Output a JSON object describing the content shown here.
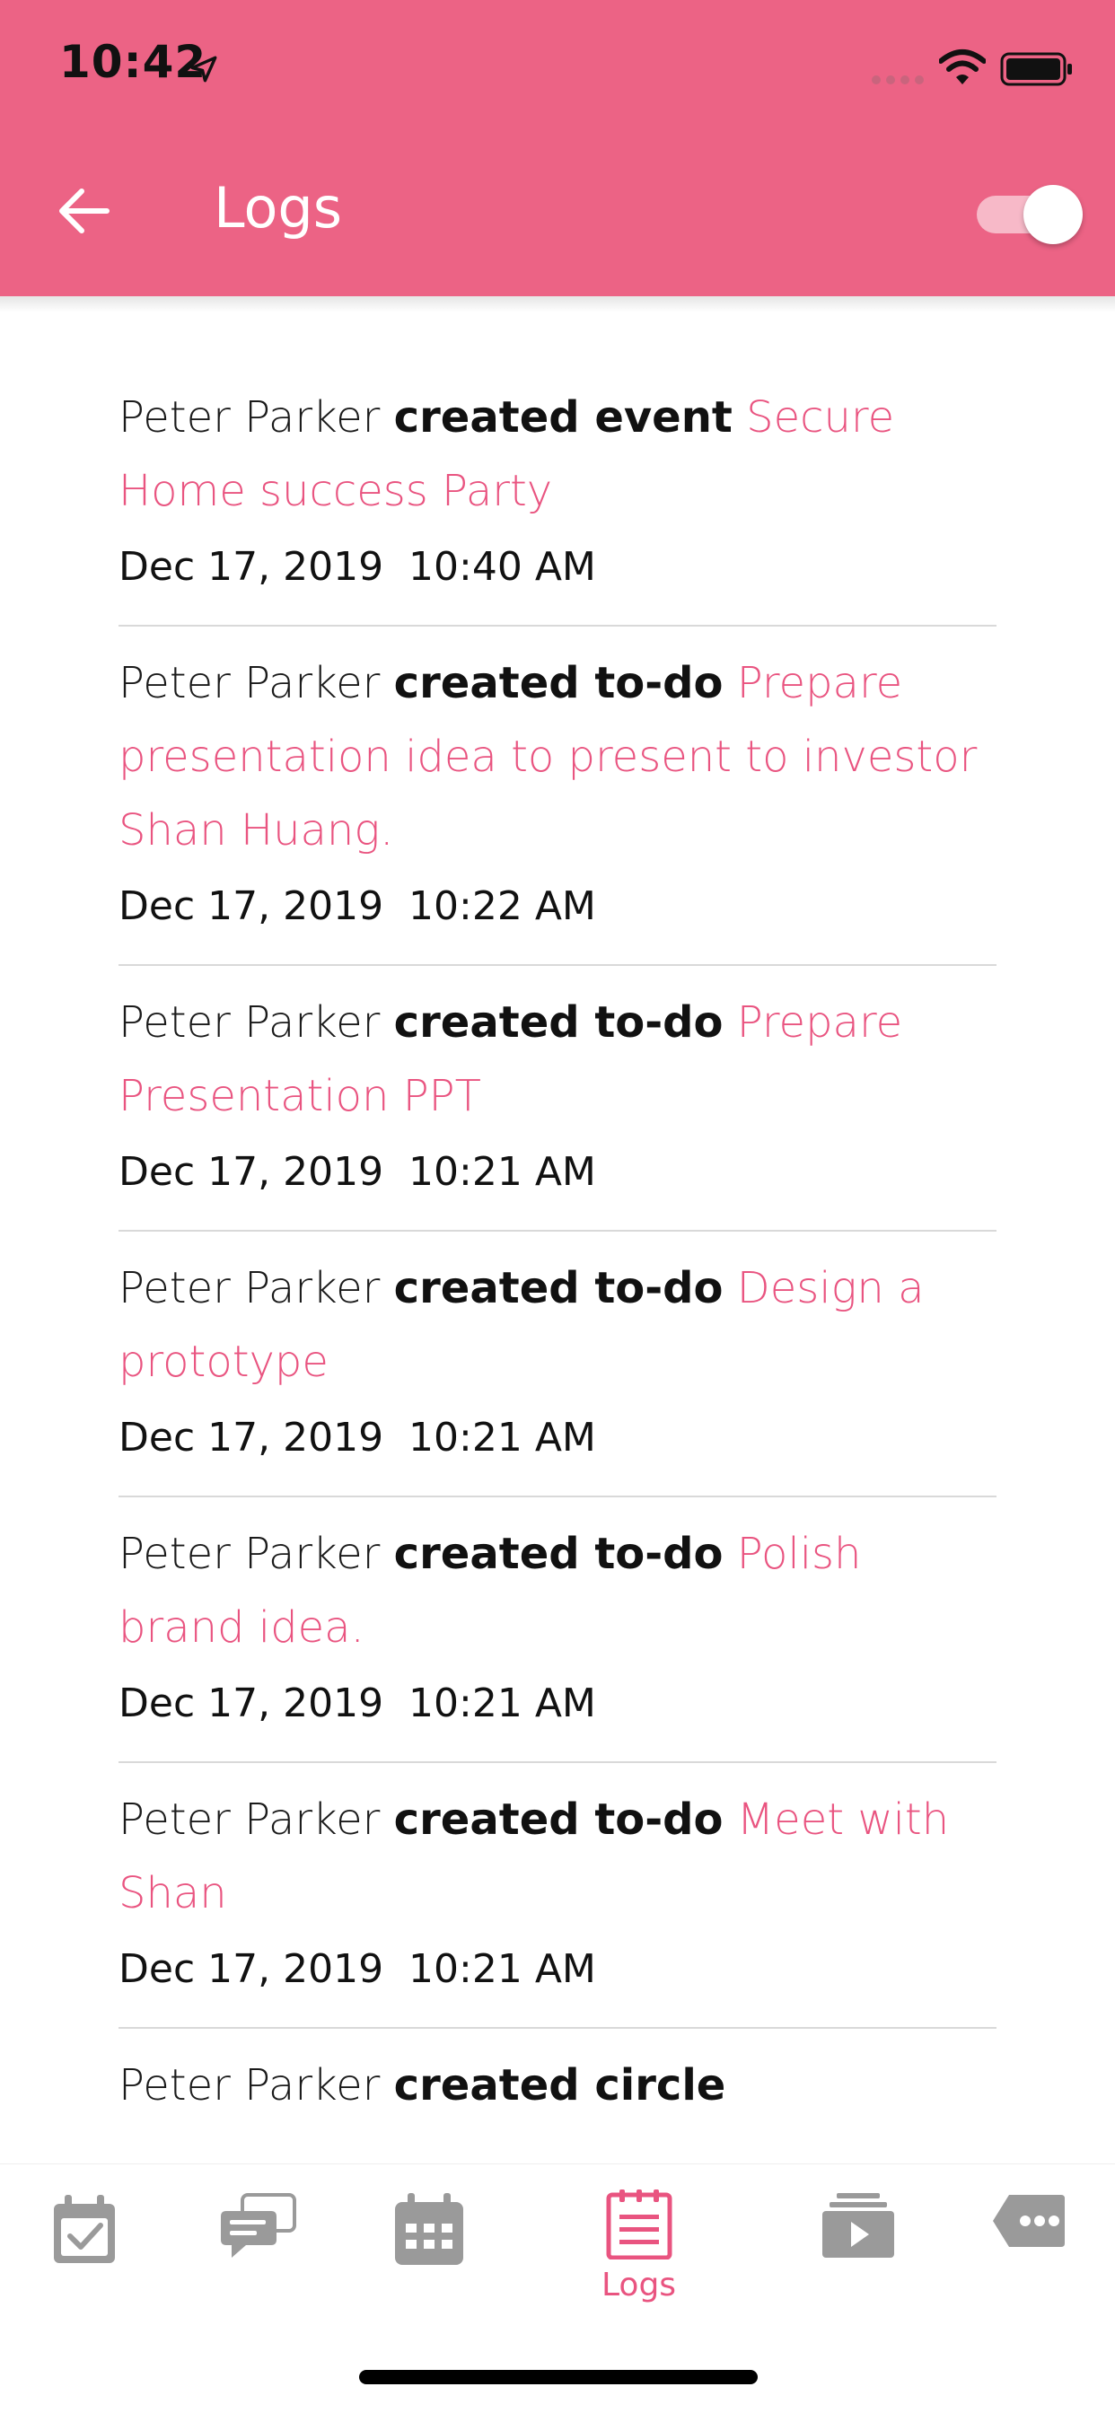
{
  "status_bar": {
    "time": "10:42"
  },
  "header": {
    "title": "Logs",
    "toggle_on": true,
    "accent": "#ec6385"
  },
  "logs": [
    {
      "actor": "Peter Parker",
      "action": "created event",
      "target": "Secure Home success Party",
      "date": "Dec 17, 2019  10:40 AM"
    },
    {
      "actor": "Peter Parker",
      "action": "created to-do",
      "target": "Prepare presentation idea to present to investor Shan Huang.",
      "date": "Dec 17, 2019  10:22 AM"
    },
    {
      "actor": "Peter Parker",
      "action": "created to-do",
      "target": "Prepare Presentation PPT",
      "date": "Dec 17, 2019  10:21 AM"
    },
    {
      "actor": "Peter Parker",
      "action": "created to-do",
      "target": "Design a prototype",
      "date": "Dec 17, 2019  10:21 AM"
    },
    {
      "actor": "Peter Parker",
      "action": "created to-do",
      "target": "Polish brand idea.",
      "date": "Dec 17, 2019  10:21 AM"
    },
    {
      "actor": "Peter Parker",
      "action": "created to-do",
      "target": "Meet with Shan",
      "date": "Dec 17, 2019  10:21 AM"
    },
    {
      "actor": "Peter Parker",
      "action": "created circle",
      "target": "",
      "date": ""
    }
  ],
  "bottom_nav": {
    "items": [
      {
        "icon": "checkbox-calendar-icon",
        "label": ""
      },
      {
        "icon": "chat-icon",
        "label": ""
      },
      {
        "icon": "calendar-grid-icon",
        "label": ""
      },
      {
        "icon": "logs-icon",
        "label": "Logs",
        "active": true
      },
      {
        "icon": "media-stack-icon",
        "label": ""
      },
      {
        "icon": "more-tag-icon",
        "label": ""
      }
    ],
    "active_color": "#e95480",
    "inactive_color": "#9a9a9a"
  }
}
